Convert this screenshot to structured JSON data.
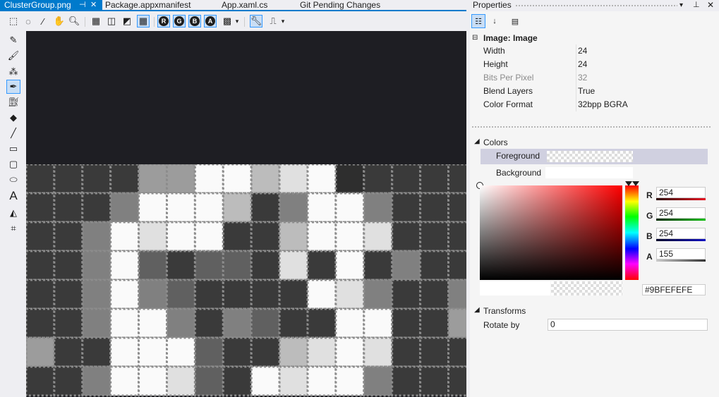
{
  "tabs": [
    {
      "label": "ClusterGroup.png",
      "active": true
    },
    {
      "label": "Package.appxmanifest",
      "active": false
    },
    {
      "label": "App.xaml.cs",
      "active": false
    },
    {
      "label": "Git Pending Changes",
      "active": false
    }
  ],
  "toolbar": {
    "channel_buttons": [
      "R",
      "G",
      "B",
      "A"
    ]
  },
  "properties": {
    "title": "Properties",
    "section": "Image: Image",
    "rows": [
      {
        "key": "Width",
        "value": "24",
        "disabled": false
      },
      {
        "key": "Height",
        "value": "24",
        "disabled": false
      },
      {
        "key": "Bits Per Pixel",
        "value": "32",
        "disabled": true
      },
      {
        "key": "Blend Layers",
        "value": "True",
        "disabled": false
      },
      {
        "key": "Color Format",
        "value": "32bpp BGRA",
        "disabled": false
      }
    ],
    "colors_header": "Colors",
    "foreground_label": "Foreground",
    "background_label": "Background",
    "channels": [
      {
        "name": "R",
        "value": "254",
        "color": "#e81123"
      },
      {
        "name": "G",
        "value": "254",
        "color": "#10c010"
      },
      {
        "name": "B",
        "value": "254",
        "color": "#1010c0"
      },
      {
        "name": "A",
        "value": "155",
        "color": "#333333"
      }
    ],
    "hex_value": "#9BFEFEFE",
    "transforms_header": "Transforms",
    "rotate_label": "Rotate by",
    "rotate_value": "0"
  },
  "colors": {
    "accent": "#007acc",
    "canvas_bg": "#1e1e23",
    "selection": "#d0d0e0"
  }
}
